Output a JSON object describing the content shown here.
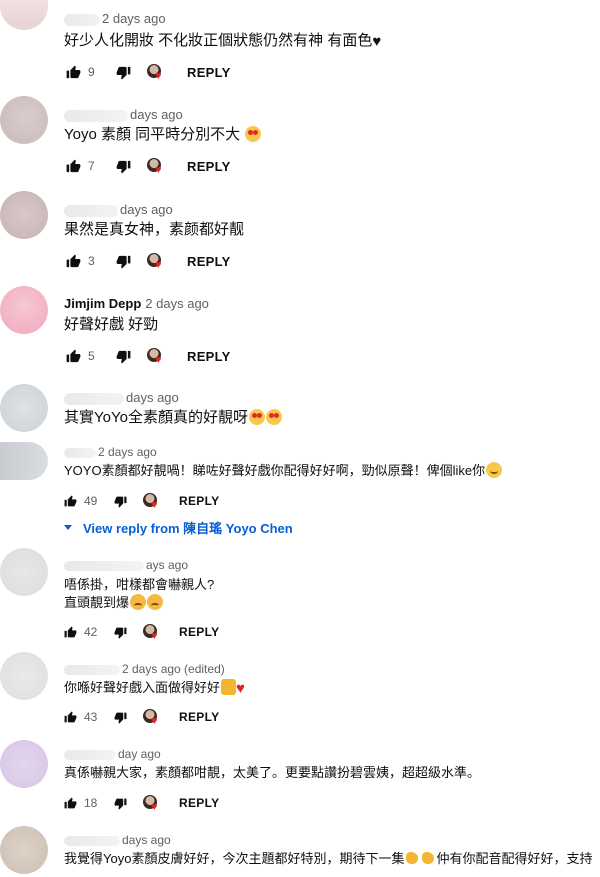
{
  "comments": [
    {
      "author": "",
      "date": "2 days ago",
      "text": "好少人化開妝 不化妝正個狀態仍然有神 有面色",
      "likes": "9",
      "reply": "REPLY"
    },
    {
      "author": "",
      "date": "days ago",
      "text": "Yoyo 素顏 同平時分別不大",
      "likes": "7",
      "reply": "REPLY"
    },
    {
      "author": "",
      "date": "days ago",
      "text": "果然是真女神，素颜都好靓",
      "likes": "3",
      "reply": "REPLY"
    },
    {
      "author": "Jimjim Depp",
      "date": "2 days ago",
      "text": "好聲好戲 好勁",
      "likes": "5",
      "reply": "REPLY"
    },
    {
      "author": "",
      "date": "days ago",
      "text": "其實YoYo全素顏真的好靚呀",
      "likes": "",
      "reply": ""
    },
    {
      "author": "",
      "date": "2 days ago",
      "text": "YOYO素顏都好靚喎！睇咗好聲好戲你配得好好啊，勁似原聲！俾個like你",
      "likes": "49",
      "reply": "REPLY"
    },
    {
      "author": "",
      "date": "ays ago",
      "text": "唔係掛，咁樣都會嚇親人?",
      "text2": "直頭靚到爆",
      "likes": "42",
      "reply": "REPLY"
    },
    {
      "author": "",
      "date": "2 days ago (edited)",
      "text": "你喺好聲好戲入面做得好好",
      "likes": "43",
      "reply": "REPLY"
    },
    {
      "author": "",
      "date": "day ago",
      "text": "真係嚇親大家，素顏都咁靚，太美了。更要點讚扮碧雲姨，超超級水準。",
      "likes": "18",
      "reply": "REPLY"
    },
    {
      "author": "",
      "date": "days ago",
      "text": "我覺得Yoyo素顏皮膚好好，今次主題都好特別，期待下一集",
      "text_tail": "仲有你配音配得好好，支持",
      "likes": "",
      "reply": ""
    }
  ],
  "view_reply": "View reply from 陳自瑤 Yoyo Chen",
  "icons": {
    "like": "thumbs-up-icon",
    "dislike": "thumbs-down-icon",
    "creator": "creator-heart-icon",
    "expand": "triangle-down-icon"
  },
  "colors": {
    "link": "#065fd4",
    "heart": "#e02424",
    "meta": "#606060"
  }
}
